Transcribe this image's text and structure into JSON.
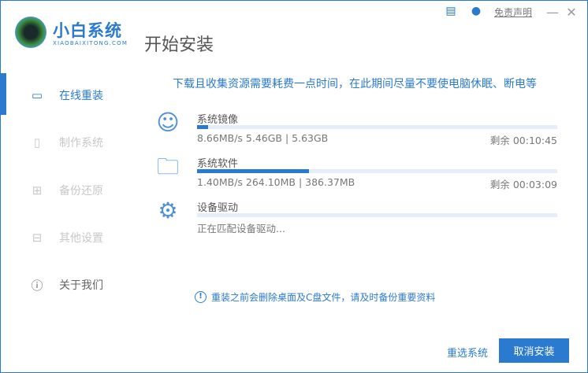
{
  "brand": {
    "name": "小白系统",
    "sub": "XIAOBAIXITONG.COM"
  },
  "page_title": "开始安装",
  "topbar": {
    "disclaimer": "免责声明",
    "minimize": "—",
    "close": "✕"
  },
  "sidebar": {
    "items": [
      {
        "label": "在线重装",
        "icon": "monitor-icon",
        "active": true
      },
      {
        "label": "制作系统",
        "icon": "usb-icon"
      },
      {
        "label": "备份还原",
        "icon": "backup-icon"
      },
      {
        "label": "其他设置",
        "icon": "toolbox-icon"
      },
      {
        "label": "关于我们",
        "icon": "info-icon"
      }
    ]
  },
  "notice": "下载且收集资源需要耗费一点时间，在此期间尽量不要使电脑休眠、断电等",
  "downloads": [
    {
      "name": "系统镜像",
      "icon": "face-icon",
      "stat": "8.66MB/s 5.46GB | 5.63GB",
      "remain": "剩余 00:10:45",
      "progress": 3
    },
    {
      "name": "系统软件",
      "icon": "folder-icon",
      "stat": "1.40MB/s 264.10MB | 386.37MB",
      "remain": "剩余 00:03:09",
      "progress": 31
    },
    {
      "name": "设备驱动",
      "icon": "gear-icon",
      "stat": "正在匹配设备驱动...",
      "progress": 0
    }
  ],
  "warning": "重装之前会删除桌面及C盘文件，请及时备份重要资料",
  "buttons": {
    "reselect": "重选系统",
    "cancel": "取消安装"
  },
  "colors": {
    "accent": "#2a7ad0"
  }
}
